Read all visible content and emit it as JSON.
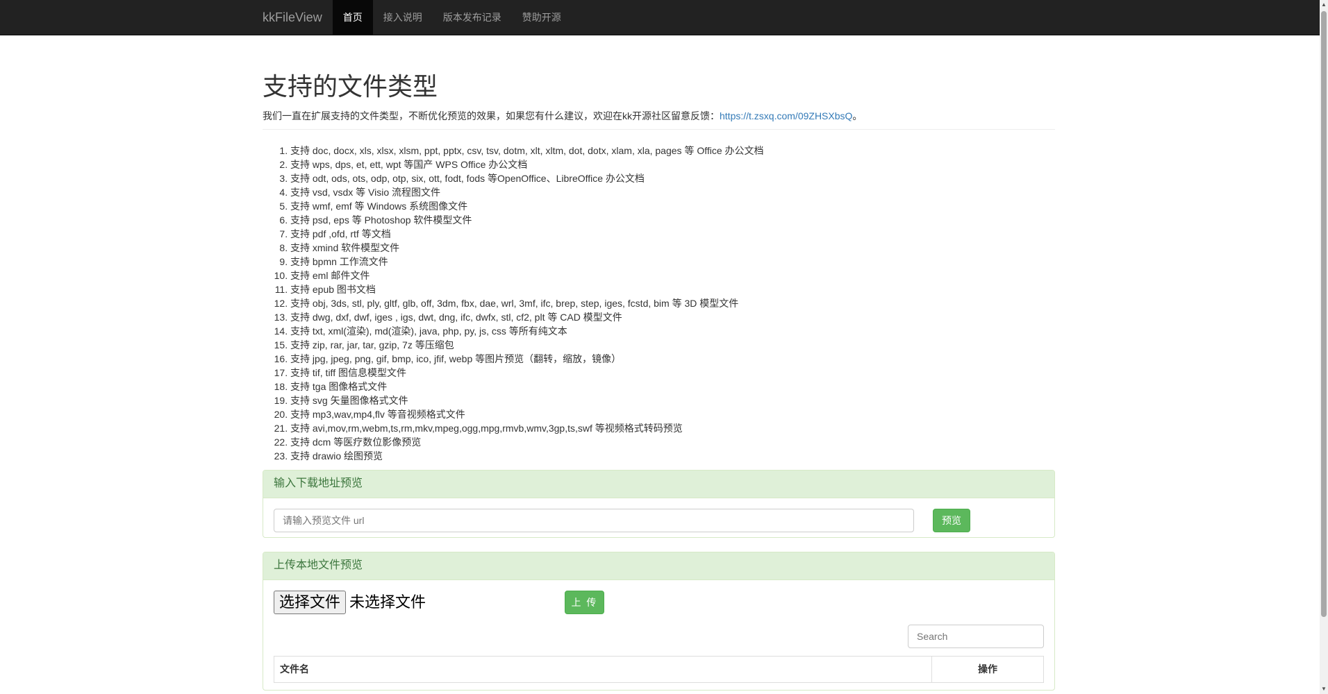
{
  "navbar": {
    "brand": "kkFileView",
    "items": [
      {
        "label": "首页",
        "active": true
      },
      {
        "label": "接入说明",
        "active": false
      },
      {
        "label": "版本发布记录",
        "active": false
      },
      {
        "label": "赞助开源",
        "active": false
      }
    ]
  },
  "header": {
    "title": "支持的文件类型",
    "intro_text": "我们一直在扩展支持的文件类型，不断优化预览的效果，如果您有什么建议，欢迎在kk开源社区留意反馈：",
    "intro_link": "https://t.zsxq.com/09ZHSXbsQ",
    "intro_suffix": "。"
  },
  "file_types": [
    "支持 doc, docx, xls, xlsx, xlsm, ppt, pptx, csv, tsv, dotm, xlt, xltm, dot, dotx, xlam, xla, pages 等 Office 办公文档",
    "支持 wps, dps, et, ett, wpt 等国产 WPS Office 办公文档",
    "支持 odt, ods, ots, odp, otp, six, ott, fodt, fods 等OpenOffice、LibreOffice 办公文档",
    "支持 vsd, vsdx 等 Visio 流程图文件",
    "支持 wmf, emf 等 Windows 系统图像文件",
    "支持 psd, eps 等 Photoshop 软件模型文件",
    "支持 pdf ,ofd, rtf 等文档",
    "支持 xmind 软件模型文件",
    "支持 bpmn 工作流文件",
    "支持 eml 邮件文件",
    "支持 epub 图书文档",
    "支持 obj, 3ds, stl, ply, gltf, glb, off, 3dm, fbx, dae, wrl, 3mf, ifc, brep, step, iges, fcstd, bim 等 3D 模型文件",
    "支持 dwg, dxf, dwf, iges , igs, dwt, dng, ifc, dwfx, stl, cf2, plt 等 CAD 模型文件",
    "支持 txt, xml(渲染), md(渲染), java, php, py, js, css 等所有纯文本",
    "支持 zip, rar, jar, tar, gzip, 7z 等压缩包",
    "支持 jpg, jpeg, png, gif, bmp, ico, jfif, webp 等图片预览（翻转，缩放，镜像）",
    "支持 tif, tiff 图信息模型文件",
    "支持 tga 图像格式文件",
    "支持 svg 矢量图像格式文件",
    "支持 mp3,wav,mp4,flv 等音视频格式文件",
    "支持 avi,mov,rm,webm,ts,rm,mkv,mpeg,ogg,mpg,rmvb,wmv,3gp,ts,swf 等视频格式转码预览",
    "支持 dcm 等医疗数位影像预览",
    "支持 drawio 绘图预览"
  ],
  "url_panel": {
    "heading": "输入下载地址预览",
    "input_placeholder": "请输入预览文件 url",
    "button_label": "预览"
  },
  "upload_panel": {
    "heading": "上传本地文件预览",
    "choose_label": "选择文件",
    "no_file_label": "未选择文件",
    "upload_label": "上 传",
    "search_placeholder": "Search",
    "table_headers": [
      "文件名",
      "操作"
    ]
  },
  "colors": {
    "navbar_bg": "#222222",
    "panel_heading_bg": "#dff0d8",
    "success": "#5cb85c",
    "link": "#337ab7"
  }
}
